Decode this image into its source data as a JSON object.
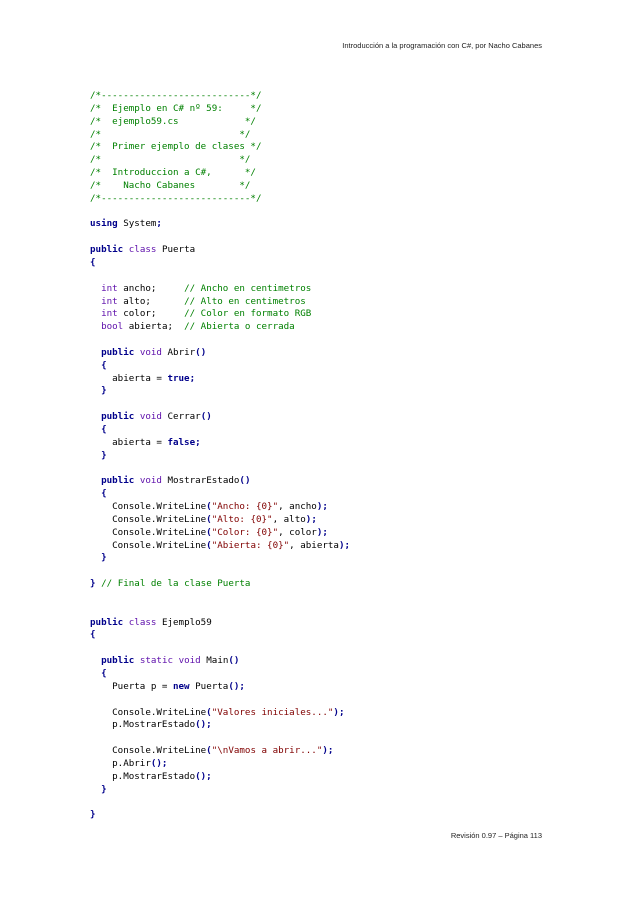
{
  "header": {
    "text": "Introducción a la programación con C#, por Nacho Cabanes"
  },
  "footer": {
    "text": "Revisión 0.97 – Página 113"
  },
  "code_lines": [
    [
      [
        "c",
        "/*---------------------------*/"
      ]
    ],
    [
      [
        "c",
        "/*  Ejemplo en C# nº 59:     */"
      ]
    ],
    [
      [
        "c",
        "/*  ejemplo59.cs            */"
      ]
    ],
    [
      [
        "c",
        "/*                         */"
      ]
    ],
    [
      [
        "c",
        "/*  Primer ejemplo de clases */"
      ]
    ],
    [
      [
        "c",
        "/*                         */"
      ]
    ],
    [
      [
        "c",
        "/*  Introduccion a C#,      */"
      ]
    ],
    [
      [
        "c",
        "/*    Nacho Cabanes        */"
      ]
    ],
    [
      [
        "c",
        "/*---------------------------*/"
      ]
    ],
    [],
    [
      [
        "k",
        "using"
      ],
      [
        "p",
        " System"
      ],
      [
        "o",
        ";"
      ]
    ],
    [],
    [
      [
        "k",
        "public"
      ],
      [
        "p",
        " "
      ],
      [
        "t",
        "class"
      ],
      [
        "p",
        " Puerta"
      ]
    ],
    [
      [
        "o",
        "{"
      ]
    ],
    [],
    [
      [
        "p",
        "  "
      ],
      [
        "t",
        "int"
      ],
      [
        "p",
        " ancho;     "
      ],
      [
        "c",
        "// Ancho en centimetros"
      ]
    ],
    [
      [
        "p",
        "  "
      ],
      [
        "t",
        "int"
      ],
      [
        "p",
        " alto;      "
      ],
      [
        "c",
        "// Alto en centimetros"
      ]
    ],
    [
      [
        "p",
        "  "
      ],
      [
        "t",
        "int"
      ],
      [
        "p",
        " color;     "
      ],
      [
        "c",
        "// Color en formato RGB"
      ]
    ],
    [
      [
        "p",
        "  "
      ],
      [
        "t",
        "bool"
      ],
      [
        "p",
        " abierta;  "
      ],
      [
        "c",
        "// Abierta o cerrada"
      ]
    ],
    [],
    [
      [
        "p",
        "  "
      ],
      [
        "k",
        "public"
      ],
      [
        "p",
        " "
      ],
      [
        "t",
        "void"
      ],
      [
        "p",
        " Abrir"
      ],
      [
        "o",
        "()"
      ]
    ],
    [
      [
        "p",
        "  "
      ],
      [
        "o",
        "{"
      ]
    ],
    [
      [
        "p",
        "    abierta = "
      ],
      [
        "k",
        "true"
      ],
      [
        "o",
        ";"
      ]
    ],
    [
      [
        "p",
        "  "
      ],
      [
        "o",
        "}"
      ]
    ],
    [],
    [
      [
        "p",
        "  "
      ],
      [
        "k",
        "public"
      ],
      [
        "p",
        " "
      ],
      [
        "t",
        "void"
      ],
      [
        "p",
        " Cerrar"
      ],
      [
        "o",
        "()"
      ]
    ],
    [
      [
        "p",
        "  "
      ],
      [
        "o",
        "{"
      ]
    ],
    [
      [
        "p",
        "    abierta = "
      ],
      [
        "k",
        "false"
      ],
      [
        "o",
        ";"
      ]
    ],
    [
      [
        "p",
        "  "
      ],
      [
        "o",
        "}"
      ]
    ],
    [],
    [
      [
        "p",
        "  "
      ],
      [
        "k",
        "public"
      ],
      [
        "p",
        " "
      ],
      [
        "t",
        "void"
      ],
      [
        "p",
        " MostrarEstado"
      ],
      [
        "o",
        "()"
      ]
    ],
    [
      [
        "p",
        "  "
      ],
      [
        "o",
        "{"
      ]
    ],
    [
      [
        "p",
        "    Console.WriteLine"
      ],
      [
        "o",
        "("
      ],
      [
        "s",
        "\"Ancho: {0}\""
      ],
      [
        "p",
        ", ancho"
      ],
      [
        "o",
        ");"
      ]
    ],
    [
      [
        "p",
        "    Console.WriteLine"
      ],
      [
        "o",
        "("
      ],
      [
        "s",
        "\"Alto: {0}\""
      ],
      [
        "p",
        ", alto"
      ],
      [
        "o",
        ");"
      ]
    ],
    [
      [
        "p",
        "    Console.WriteLine"
      ],
      [
        "o",
        "("
      ],
      [
        "s",
        "\"Color: {0}\""
      ],
      [
        "p",
        ", color"
      ],
      [
        "o",
        ");"
      ]
    ],
    [
      [
        "p",
        "    Console.WriteLine"
      ],
      [
        "o",
        "("
      ],
      [
        "s",
        "\"Abierta: {0}\""
      ],
      [
        "p",
        ", abierta"
      ],
      [
        "o",
        ");"
      ]
    ],
    [
      [
        "p",
        "  "
      ],
      [
        "o",
        "}"
      ]
    ],
    [],
    [
      [
        "o",
        "}"
      ],
      [
        "p",
        " "
      ],
      [
        "c",
        "// Final de la clase Puerta"
      ]
    ],
    [],
    [],
    [
      [
        "k",
        "public"
      ],
      [
        "p",
        " "
      ],
      [
        "t",
        "class"
      ],
      [
        "p",
        " Ejemplo59"
      ]
    ],
    [
      [
        "o",
        "{"
      ]
    ],
    [],
    [
      [
        "p",
        "  "
      ],
      [
        "k",
        "public"
      ],
      [
        "p",
        " "
      ],
      [
        "t",
        "static"
      ],
      [
        "p",
        " "
      ],
      [
        "t",
        "void"
      ],
      [
        "p",
        " Main"
      ],
      [
        "o",
        "()"
      ]
    ],
    [
      [
        "p",
        "  "
      ],
      [
        "o",
        "{"
      ]
    ],
    [
      [
        "p",
        "    Puerta p = "
      ],
      [
        "k",
        "new"
      ],
      [
        "p",
        " Puerta"
      ],
      [
        "o",
        "();"
      ]
    ],
    [],
    [
      [
        "p",
        "    Console.WriteLine"
      ],
      [
        "o",
        "("
      ],
      [
        "s",
        "\"Valores iniciales...\""
      ],
      [
        "o",
        ");"
      ]
    ],
    [
      [
        "p",
        "    p.MostrarEstado"
      ],
      [
        "o",
        "();"
      ]
    ],
    [],
    [
      [
        "p",
        "    Console.WriteLine"
      ],
      [
        "o",
        "("
      ],
      [
        "s",
        "\"\\nVamos a abrir...\""
      ],
      [
        "o",
        ");"
      ]
    ],
    [
      [
        "p",
        "    p.Abrir"
      ],
      [
        "o",
        "();"
      ]
    ],
    [
      [
        "p",
        "    p.MostrarEstado"
      ],
      [
        "o",
        "();"
      ]
    ],
    [
      [
        "p",
        "  "
      ],
      [
        "o",
        "}"
      ]
    ],
    [],
    [
      [
        "o",
        "}"
      ]
    ]
  ],
  "colors": {
    "comment": "#008000",
    "keyword": "#00008b",
    "type": "#5e0fab",
    "string": "#800000",
    "text": "#000000"
  }
}
